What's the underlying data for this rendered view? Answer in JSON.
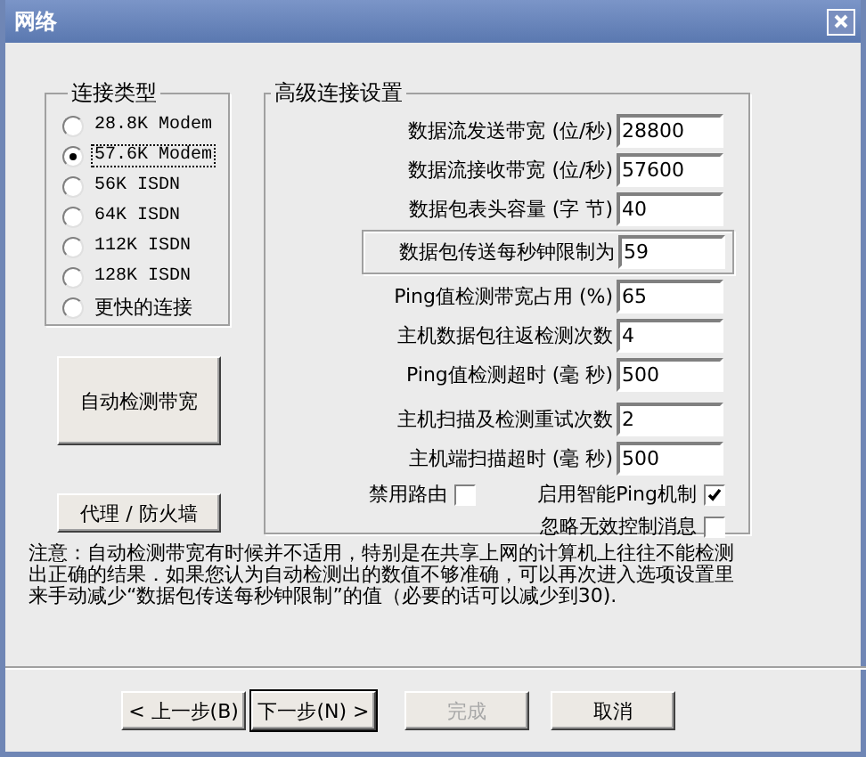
{
  "window": {
    "title": "网络"
  },
  "connection_type": {
    "title": "连接类型",
    "options": [
      {
        "label": "28.8K Modem",
        "selected": false,
        "focused": false
      },
      {
        "label": "57.6K Modem",
        "selected": true,
        "focused": true
      },
      {
        "label": "56K ISDN",
        "selected": false,
        "focused": false
      },
      {
        "label": "64K ISDN",
        "selected": false,
        "focused": false
      },
      {
        "label": "112K ISDN",
        "selected": false,
        "focused": false
      },
      {
        "label": "128K ISDN",
        "selected": false,
        "focused": false
      },
      {
        "label": "更快的连接",
        "selected": false,
        "focused": false
      }
    ]
  },
  "side_buttons": [
    "自动检测带宽",
    "代理 / 防火墙"
  ],
  "advanced": {
    "title": "高级连接设置",
    "fields": [
      {
        "label": "数据流发送带宽 (位/秒)",
        "value": "28800",
        "framed": false
      },
      {
        "label": "数据流接收带宽 (位/秒)",
        "value": "57600",
        "framed": false
      },
      {
        "label": "数据包表头容量 (字 节)",
        "value": "40",
        "framed": false
      },
      {
        "label": "数据包传送每秒钟限制为",
        "value": "59",
        "framed": true
      },
      {
        "label": "Ping值检测带宽占用 (%)",
        "value": "65",
        "framed": false
      },
      {
        "label": "主机数据包往返检测次数",
        "value": "4",
        "framed": false
      },
      {
        "label": "Ping值检测超时 (毫 秒)",
        "value": "500",
        "framed": false
      },
      {
        "label": "主机扫描及检测重试次数",
        "value": "2",
        "framed": false
      },
      {
        "label": "主机端扫描超时 (毫 秒)",
        "value": "500",
        "framed": false
      }
    ],
    "checkboxes": [
      {
        "label": "禁用路由",
        "checked": false
      },
      {
        "label": "启用智能Ping机制",
        "checked": true
      },
      {
        "label": "忽略无效控制消息",
        "checked": false
      }
    ]
  },
  "note": "注意：自动检测带宽有时候并不适用，特别是在共享上网的计算机上往往不能检测出正确的结果．如果您认为自动检测出的数值不够准确，可以再次进入选项设置里来手动减少“数据包传送每秒钟限制”的值（必要的话可以减少到30).",
  "buttons": [
    {
      "label": "< 上一步(B)",
      "default": false,
      "disabled": false
    },
    {
      "label": "下一步(N) >",
      "default": true,
      "disabled": false
    },
    {
      "label": "完成",
      "default": false,
      "disabled": true
    },
    {
      "label": "取消",
      "default": false,
      "disabled": false
    }
  ]
}
